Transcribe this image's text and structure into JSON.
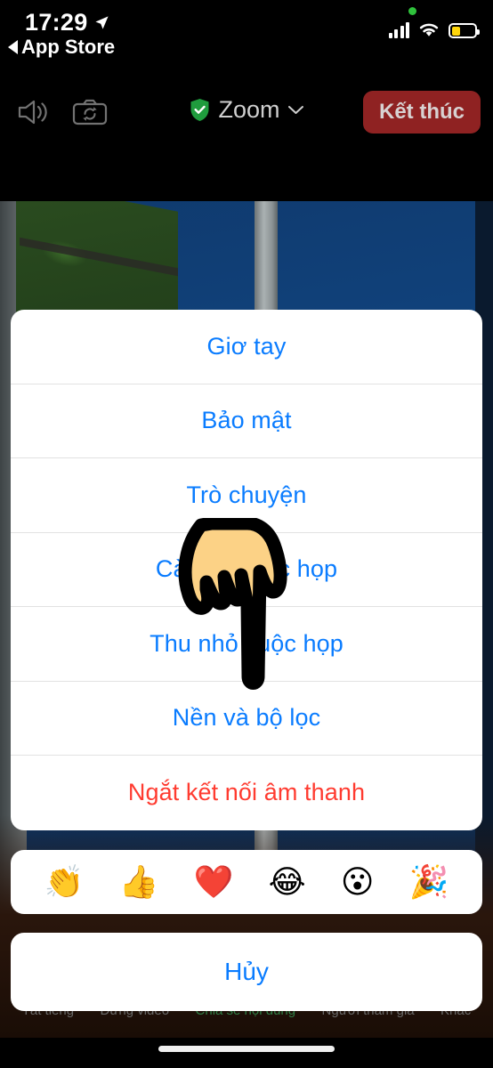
{
  "status_bar": {
    "time": "17:29",
    "location_icon": "location-arrow-icon",
    "back_label": "App Store",
    "back_icon": "back-triangle-icon",
    "recording_dot": "green-recording-dot",
    "signal_icon": "cellular-signal-icon",
    "wifi_icon": "wifi-icon",
    "battery_icon": "battery-low-power-icon",
    "battery_level_percent": 33,
    "battery_color": "#ffd60a"
  },
  "top_bar": {
    "speaker_icon": "speaker-icon",
    "flip_camera_icon": "flip-camera-icon",
    "shield_icon": "green-shield-check-icon",
    "app_title": "Zoom",
    "chevron_icon": "chevron-down-icon",
    "end_button_label": "Kết thúc",
    "end_button_color": "#8f2222"
  },
  "action_sheet": {
    "items": [
      {
        "label": "Giơ tay",
        "style": "default"
      },
      {
        "label": "Bảo mật",
        "style": "default"
      },
      {
        "label": "Trò chuyện",
        "style": "default"
      },
      {
        "label": "Cài đặt cuộc họp",
        "style": "default"
      },
      {
        "label": "Thu nhỏ cuộc họp",
        "style": "default"
      },
      {
        "label": "Nền và bộ lọc",
        "style": "default"
      },
      {
        "label": "Ngắt kết nối âm thanh",
        "style": "destructive"
      }
    ],
    "tint_color": "#0a7cff",
    "destructive_color": "#ff3b30"
  },
  "reactions": [
    {
      "name": "clapping-hands-emoji",
      "glyph": "👏"
    },
    {
      "name": "thumbs-up-emoji",
      "glyph": "👍"
    },
    {
      "name": "red-heart-emoji",
      "glyph": "❤️"
    },
    {
      "name": "face-with-tears-of-joy-emoji",
      "glyph": "😂"
    },
    {
      "name": "open-mouth-face-emoji",
      "glyph": "😮"
    },
    {
      "name": "party-popper-emoji",
      "glyph": "🎉"
    }
  ],
  "cancel": {
    "label": "Hủy"
  },
  "bottom_toolbar": {
    "items": [
      {
        "label": "Tắt tiếng",
        "highlighted": false
      },
      {
        "label": "Dừng video",
        "highlighted": false
      },
      {
        "label": "Chia sẻ nội dung",
        "highlighted": true
      },
      {
        "label": "Người tham gia",
        "highlighted": false
      },
      {
        "label": "Khác",
        "highlighted": false
      }
    ],
    "highlight_color": "#2f7d45"
  },
  "cursor": {
    "icon": "pointing-down-hand-cursor"
  },
  "home_indicator": {
    "name": "home-indicator"
  }
}
